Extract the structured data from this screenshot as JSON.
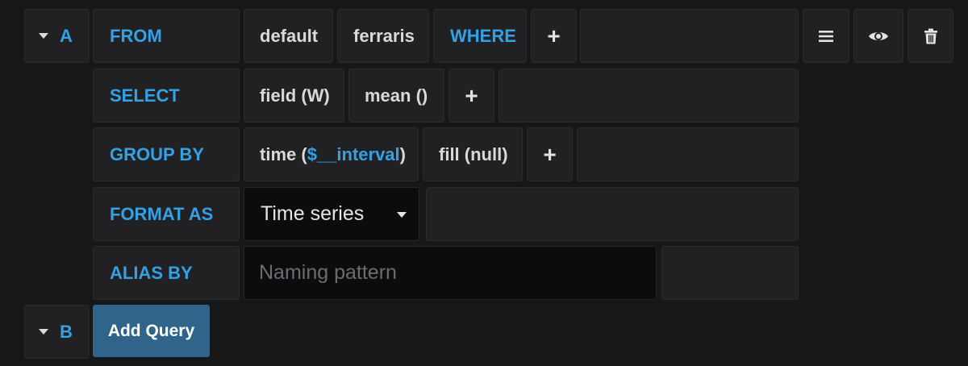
{
  "query_a": {
    "ref_id": "A",
    "from": {
      "keyword": "FROM",
      "policy": "default",
      "measurement": "ferraris",
      "where_keyword": "WHERE",
      "add_symbol": "+"
    },
    "select": {
      "keyword": "SELECT",
      "field": "field (W)",
      "function": "mean ()",
      "add_symbol": "+"
    },
    "group_by": {
      "keyword": "GROUP BY",
      "time_prefix": "time (",
      "time_variable": "$__interval",
      "time_suffix": ")",
      "fill": "fill (null)",
      "add_symbol": "+"
    },
    "format_as": {
      "keyword": "FORMAT AS",
      "selected": "Time series"
    },
    "alias_by": {
      "keyword": "ALIAS BY",
      "placeholder": "Naming pattern",
      "value": ""
    },
    "actions": {
      "menu_icon": "hamburger-menu-icon",
      "visibility_icon": "eye-icon",
      "delete_icon": "trash-icon"
    }
  },
  "query_b": {
    "ref_id": "B",
    "add_query_label": "Add Query"
  },
  "colors": {
    "keyword": "#33a2e5",
    "background": "#161719",
    "cell": "#212124",
    "button_primary": "#31648a"
  }
}
